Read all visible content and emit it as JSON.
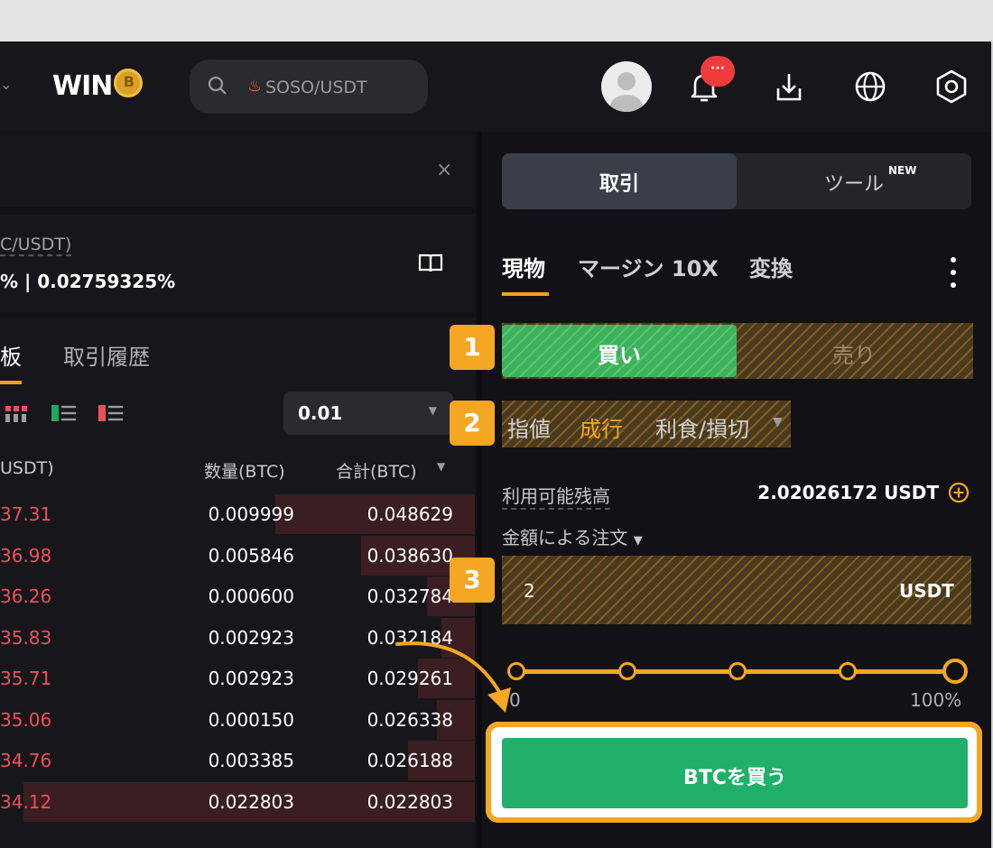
{
  "header": {
    "logo_text": "WIN",
    "logo_coin": "B",
    "search_placeholder": "SOSO/USDT",
    "notification_badge": "···"
  },
  "left_panel": {
    "pair_label": "C/USDT)",
    "rate_text": "% | 0.02759325%",
    "tabs": [
      "板",
      "取引履歴"
    ],
    "precision_value": "0.01",
    "headers": {
      "price": "USDT)",
      "qty": "数量(BTC)",
      "total": "合計(BTC)"
    },
    "orders": [
      {
        "price": "37.31",
        "qty": "0.009999",
        "total": "0.048629",
        "depth": 0.42
      },
      {
        "price": "36.98",
        "qty": "0.005846",
        "total": "0.038630",
        "depth": 0.24
      },
      {
        "price": "36.26",
        "qty": "0.000600",
        "total": "0.032784",
        "depth": 0.1
      },
      {
        "price": "35.83",
        "qty": "0.002923",
        "total": "0.032184",
        "depth": 0.07
      },
      {
        "price": "35.71",
        "qty": "0.002923",
        "total": "0.029261",
        "depth": 0.12
      },
      {
        "price": "35.06",
        "qty": "0.000150",
        "total": "0.026338",
        "depth": 0.08
      },
      {
        "price": "34.76",
        "qty": "0.003385",
        "total": "0.026188",
        "depth": 0.14
      },
      {
        "price": "34.12",
        "qty": "0.022803",
        "total": "0.022803",
        "depth": 0.95
      }
    ]
  },
  "right_panel": {
    "seg_tabs": [
      "取引",
      "ツール"
    ],
    "new_label": "NEW",
    "market_tabs": [
      "現物",
      "マージン 10X",
      "変換"
    ],
    "buy_label": "買い",
    "sell_label": "売り",
    "order_types": [
      "指値",
      "成行",
      "利食/損切"
    ],
    "balance_label": "利用可能残高",
    "balance_value": "2.02026172 USDT",
    "amount_mode": "金額による注文",
    "amount_value": "2",
    "amount_unit": "USDT",
    "slider_min": "0",
    "slider_max": "100%",
    "slider_level": 1.0,
    "submit_label": "BTCを買う",
    "step_badges": [
      "1",
      "2",
      "3"
    ]
  },
  "colors": {
    "accent": "#f5a623",
    "buy": "#20b06a",
    "sell_price": "#ef4f5a"
  }
}
